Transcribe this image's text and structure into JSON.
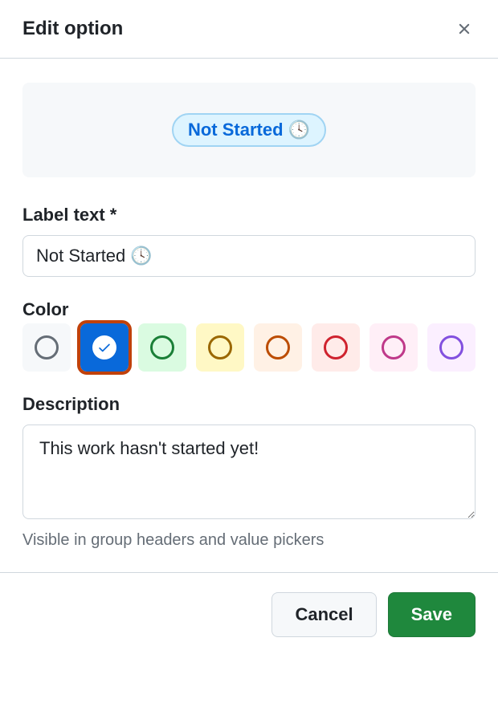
{
  "header": {
    "title": "Edit option"
  },
  "preview": {
    "pill_text": "Not Started 🕓"
  },
  "labelText": {
    "label": "Label text *",
    "value": "Not Started 🕓"
  },
  "color": {
    "label": "Color",
    "options": [
      {
        "name": "gray",
        "selected": false
      },
      {
        "name": "blue",
        "selected": true
      },
      {
        "name": "green",
        "selected": false
      },
      {
        "name": "yellow",
        "selected": false
      },
      {
        "name": "orange",
        "selected": false
      },
      {
        "name": "red",
        "selected": false
      },
      {
        "name": "pink",
        "selected": false
      },
      {
        "name": "purple",
        "selected": false
      }
    ]
  },
  "description": {
    "label": "Description",
    "value": "This work hasn't started yet!",
    "helper": "Visible in group headers and value pickers"
  },
  "footer": {
    "cancel": "Cancel",
    "save": "Save"
  }
}
